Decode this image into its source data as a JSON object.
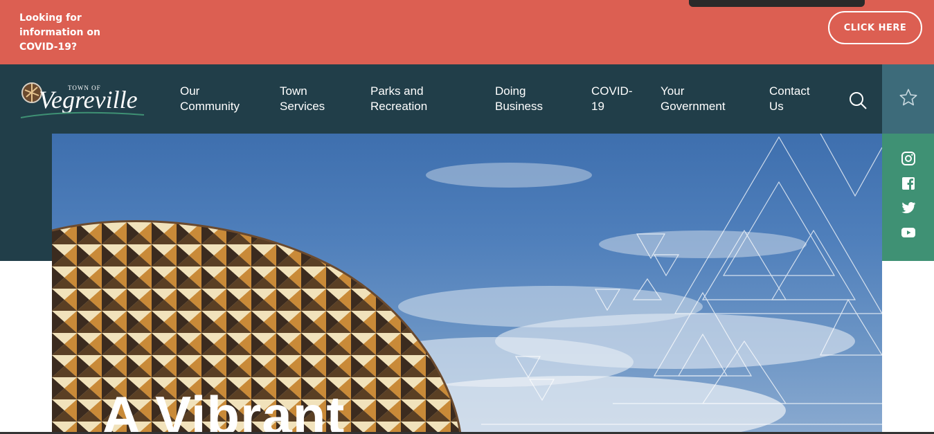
{
  "alert": {
    "text": "Looking for information on COVID-19?",
    "button_label": "CLICK HERE"
  },
  "logo": {
    "top_text": "TOWN OF",
    "name": "Vegreville"
  },
  "nav": {
    "items": [
      {
        "label": "Our\nCommunity"
      },
      {
        "label": "Town\nServices"
      },
      {
        "label": "Parks and\nRecreation"
      },
      {
        "label": "Doing\nBusiness"
      },
      {
        "label": "COVID-\n19"
      },
      {
        "label": "Your\nGovernment"
      },
      {
        "label": "Contact\nUs"
      }
    ]
  },
  "icons": {
    "search": "search-icon",
    "star": "star-icon",
    "social": [
      "instagram-icon",
      "facebook-icon",
      "twitter-icon",
      "youtube-icon"
    ]
  },
  "hero": {
    "title": "A Vibrant"
  },
  "colors": {
    "alert_bg": "#dc5f52",
    "nav_bg": "#213e49",
    "star_panel": "#3d6b7a",
    "social_panel": "#3f9174"
  }
}
